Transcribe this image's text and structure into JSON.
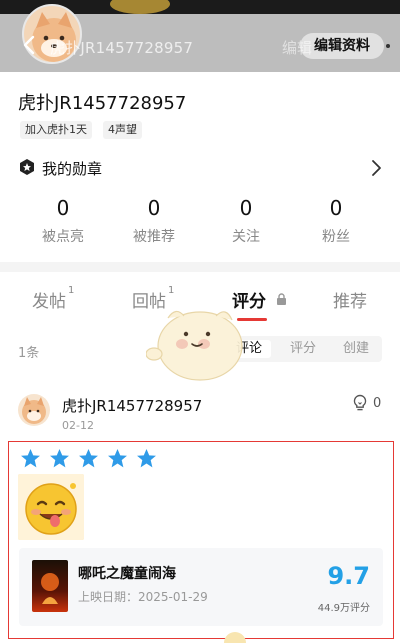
{
  "header": {
    "title": "虎扑JR1457728957",
    "ghost_text": "编辑",
    "edit_button": "编辑资料"
  },
  "profile": {
    "username": "虎扑JR1457728957",
    "tags": [
      "加入虎扑1天",
      "4声望"
    ],
    "medal_label": "我的勋章",
    "stats": [
      {
        "value": "0",
        "label": "被点亮"
      },
      {
        "value": "0",
        "label": "被推荐"
      },
      {
        "value": "0",
        "label": "关注"
      },
      {
        "value": "0",
        "label": "粉丝"
      }
    ]
  },
  "tabs": [
    {
      "label": "发帖",
      "count": "1"
    },
    {
      "label": "回帖",
      "count": "1"
    },
    {
      "label": "评分",
      "count": ""
    },
    {
      "label": "推荐",
      "count": ""
    }
  ],
  "list": {
    "count_label": "1条",
    "subtabs": [
      "评论",
      "评分",
      "创建"
    ]
  },
  "post": {
    "username": "虎扑JR1457728957",
    "date": "02-12",
    "likes": "0",
    "star_count": 5,
    "star_color": "#2f9be8",
    "movie": {
      "title": "哪吒之魔童闹海",
      "release": "上映日期：2025-01-29",
      "score": "9.7",
      "votes": "44.9万评分"
    }
  },
  "colors": {
    "accent_red": "#e53935",
    "score_blue": "#23a0e6"
  }
}
